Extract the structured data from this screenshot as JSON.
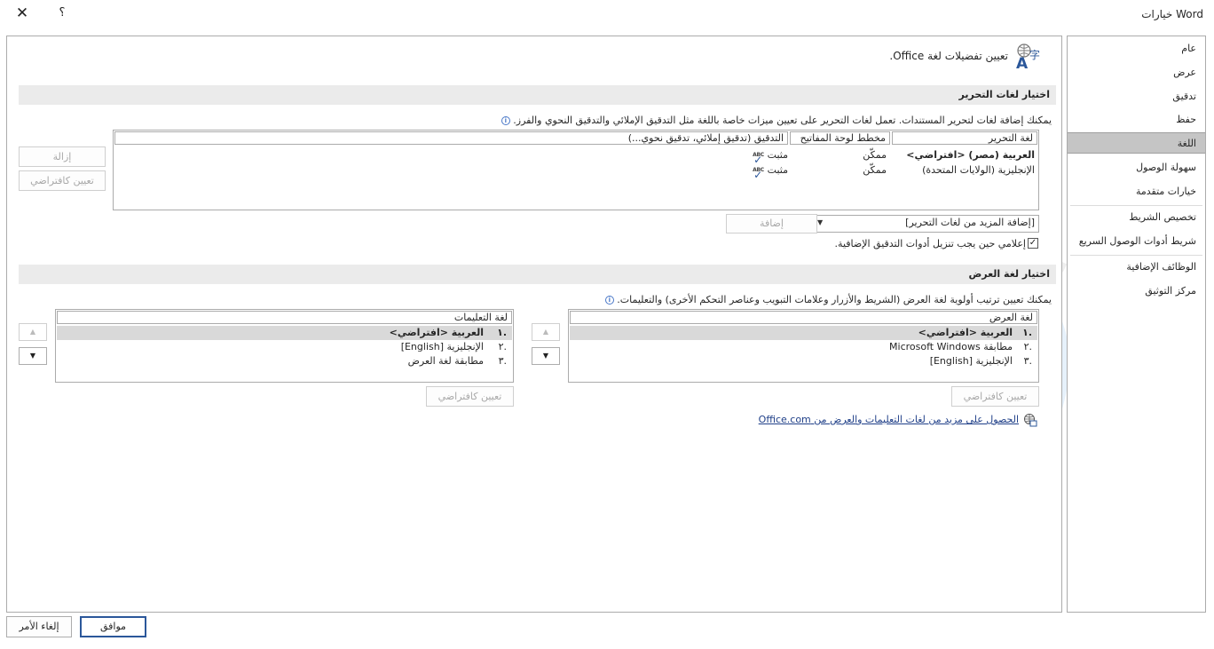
{
  "window": {
    "title": "خيارات Word",
    "close_glyph": "✕",
    "help_glyph": "؟"
  },
  "sidebar": {
    "items": [
      {
        "label": "عام"
      },
      {
        "label": "عرض"
      },
      {
        "label": "تدقيق"
      },
      {
        "label": "حفظ"
      },
      {
        "label": "اللغة"
      },
      {
        "label": "سهولة الوصول"
      },
      {
        "label": "خيارات متقدمة"
      },
      {
        "label": "تخصيص الشريط"
      },
      {
        "label": "شريط أدوات الوصول السريع"
      },
      {
        "label": "الوظائف الإضافية"
      },
      {
        "label": "مركز التوثيق"
      }
    ],
    "selected": "اللغة"
  },
  "header": {
    "text": "تعيين تفضيلات لغة Office."
  },
  "editing": {
    "section_title": "اختيار لغات التحرير",
    "description": "يمكنك إضافة لغات لتحرير المستندات. تعمل لغات التحرير على تعيين ميزات خاصة باللغة مثل التدقيق الإملائي والتدقيق النحوي والفرز.",
    "columns": [
      "لغة التحرير",
      "مخطط لوحة المفاتيح",
      "التدقيق (تدقيق إملائي، تدقيق نحوي...)"
    ],
    "rows": [
      {
        "language": "العربية (مصر) <افتراضي>",
        "keyboard": "ممكّن",
        "proofing": "مثبت",
        "abc": "ABC"
      },
      {
        "language": "الإنجليزية (الولايات المتحدة)",
        "keyboard": "ممكّن",
        "proofing": "مثبت",
        "abc": "ABC"
      }
    ],
    "remove_button": "إزالة",
    "set_default_button": "تعيين كافتراضي",
    "add_combo_value": "[إضافة المزيد من لغات التحرير]",
    "add_button": "إضافة",
    "notify_checkbox_label": "إعلامي حين يجب تنزيل أدوات التدقيق الإضافية.",
    "notify_checked": true,
    "check_glyph": "✓",
    "combo_arrow": "▼"
  },
  "display": {
    "section_title": "اختيار لغة العرض",
    "description": "يمكنك تعيين ترتيب أولوية لغة العرض (الشريط والأزرار وعلامات التبويب وعناصر التحكم الأخرى) والتعليمات.",
    "display_header": "لغة العرض",
    "display_items": [
      {
        "num": "١.",
        "label": "العربية <افتراضي>"
      },
      {
        "num": "٢.",
        "label": "مطابقة Microsoft Windows"
      },
      {
        "num": "٣.",
        "label": "الإنجليزية [English]"
      }
    ],
    "help_header": "لغة التعليمات",
    "help_items": [
      {
        "num": "١.",
        "label": "العربية <افتراضي>"
      },
      {
        "num": "٢.",
        "label": "الإنجليزية [English]"
      },
      {
        "num": "٣.",
        "label": "مطابقة لغة العرض"
      }
    ],
    "set_default_button": "تعيين كافتراضي",
    "help_set_default_button": "تعيين كافتراضي",
    "link_text": "الحصول على مزيد من لغات التعليمات والعرض من Office.com",
    "up_glyph": "▲",
    "down_glyph": "▼"
  },
  "footer": {
    "ok_button": "موافق",
    "cancel_button": "إلغاء الأمر"
  },
  "info_glyph": "i",
  "watermark": {
    "text": "تـرايـد سـوفـت"
  },
  "colors": {
    "accent": "#2b579a",
    "selected_nav": "#c5c5c5",
    "section_bar": "#ebebeb"
  },
  "icons": {
    "header": "language-globe-icon",
    "link": "globe-link-icon"
  }
}
